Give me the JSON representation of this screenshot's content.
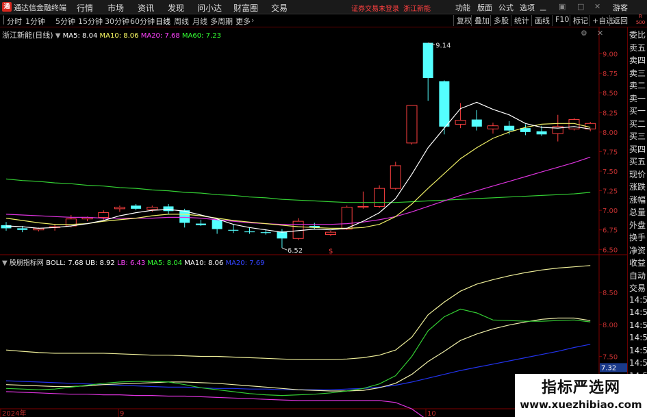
{
  "app": {
    "title": "通达信金融终端",
    "logo_glyph": "通"
  },
  "menu": [
    "行情",
    "市场",
    "资讯",
    "发现",
    "问小达",
    "财富圈",
    "交易"
  ],
  "notice": {
    "broker": "证券交易未登录",
    "stock": "浙江新能"
  },
  "right_menu": [
    "功能",
    "版面",
    "公式",
    "选项"
  ],
  "user": "游客",
  "toolbar": {
    "periods": [
      "分时",
      "1分钟",
      "5分钟",
      "15分钟",
      "30分钟",
      "60分钟",
      "日线",
      "周线",
      "月线",
      "多周期",
      "更多"
    ],
    "active": "日线",
    "right": [
      "复权",
      "叠加",
      "多股",
      "统计",
      "画线",
      "F10",
      "标记",
      "+自选",
      "返回"
    ]
  },
  "side_panel": [
    "委比",
    "卖五",
    "卖四",
    "卖三",
    "卖二",
    "卖一",
    "买一",
    "买二",
    "买三",
    "买四",
    "买五",
    "现价",
    "涨跌",
    "涨幅",
    "总量",
    "外盘",
    "换手",
    "净资",
    "收益",
    "自动",
    "交易",
    "14:56",
    "14:56",
    "14:56",
    "14:56",
    "14:56",
    "14:56",
    "14:56",
    "14:56",
    "14:56"
  ],
  "rbadge": [
    "R",
    "500"
  ],
  "price_panel": {
    "stock_label": "浙江新能(日线)",
    "ma": [
      {
        "label": "MA5: 8.04",
        "color": "#ffffff"
      },
      {
        "label": "MA10: 8.06",
        "color": "#ffff66"
      },
      {
        "label": "MA20: 7.68",
        "color": "#ff44ff"
      },
      {
        "label": "MA60: 7.23",
        "color": "#33ff33"
      }
    ],
    "y_ticks": [
      "9.00",
      "8.75",
      "8.50",
      "8.25",
      "8.00",
      "7.75",
      "7.50",
      "7.25",
      "7.00",
      "6.75",
      "6.50"
    ],
    "high_label": "9.14",
    "low_label": "6.52",
    "marker": "$"
  },
  "boll_panel": {
    "label": "股朋指标网",
    "boll": {
      "label": "BOLL: 7.68",
      "color": "#ffffff"
    },
    "items": [
      {
        "label": "UB: 8.92",
        "color": "#ffffff"
      },
      {
        "label": "LB: 6.43",
        "color": "#ff44ff"
      },
      {
        "label": "MA5: 8.04",
        "color": "#33ff33"
      },
      {
        "label": "MA10: 8.06",
        "color": "#ffffff"
      },
      {
        "label": "MA20: 7.69",
        "color": "#3344ff"
      }
    ],
    "y_ticks": [
      "8.50",
      "8.00",
      "7.50",
      "7.00"
    ],
    "current_value": "7.32"
  },
  "x_axis": [
    "2024年",
    "9",
    "10"
  ],
  "watermark": {
    "title": "指标严选网",
    "url": "www.xuezhibiao.com"
  },
  "chart_data": {
    "type": "candlestick",
    "y_range": [
      6.45,
      9.25
    ],
    "candles": [
      {
        "o": 6.81,
        "h": 6.85,
        "l": 6.74,
        "c": 6.77
      },
      {
        "o": 6.77,
        "h": 6.8,
        "l": 6.72,
        "c": 6.75
      },
      {
        "o": 6.75,
        "h": 6.78,
        "l": 6.73,
        "c": 6.77
      },
      {
        "o": 6.78,
        "h": 6.82,
        "l": 6.74,
        "c": 6.79
      },
      {
        "o": 6.8,
        "h": 6.94,
        "l": 6.78,
        "c": 6.89
      },
      {
        "o": 6.89,
        "h": 6.92,
        "l": 6.86,
        "c": 6.91
      },
      {
        "o": 6.91,
        "h": 7.0,
        "l": 6.88,
        "c": 6.97
      },
      {
        "o": 7.02,
        "h": 7.06,
        "l": 6.98,
        "c": 7.04
      },
      {
        "o": 7.06,
        "h": 7.08,
        "l": 7.0,
        "c": 7.02
      },
      {
        "o": 7.01,
        "h": 7.06,
        "l": 6.98,
        "c": 7.04
      },
      {
        "o": 7.05,
        "h": 7.08,
        "l": 6.95,
        "c": 6.99
      },
      {
        "o": 7.0,
        "h": 7.02,
        "l": 6.78,
        "c": 6.84
      },
      {
        "o": 6.83,
        "h": 6.88,
        "l": 6.8,
        "c": 6.81
      },
      {
        "o": 6.88,
        "h": 6.9,
        "l": 6.7,
        "c": 6.76
      },
      {
        "o": 6.75,
        "h": 6.82,
        "l": 6.71,
        "c": 6.74
      },
      {
        "o": 6.73,
        "h": 6.78,
        "l": 6.7,
        "c": 6.72
      },
      {
        "o": 6.72,
        "h": 6.76,
        "l": 6.69,
        "c": 6.71
      },
      {
        "o": 6.73,
        "h": 6.76,
        "l": 6.52,
        "c": 6.64
      },
      {
        "o": 6.64,
        "h": 6.9,
        "l": 6.62,
        "c": 6.86
      },
      {
        "o": 6.8,
        "h": 6.84,
        "l": 6.76,
        "c": 6.78
      },
      {
        "o": 6.69,
        "h": 6.74,
        "l": 6.67,
        "c": 6.72
      },
      {
        "o": 6.76,
        "h": 7.06,
        "l": 6.75,
        "c": 7.04
      },
      {
        "o": 7.04,
        "h": 7.24,
        "l": 7.02,
        "c": 7.05
      },
      {
        "o": 7.05,
        "h": 7.32,
        "l": 7.03,
        "c": 7.28
      },
      {
        "o": 7.28,
        "h": 7.62,
        "l": 7.26,
        "c": 7.57
      },
      {
        "o": 7.86,
        "h": 8.34,
        "l": 7.84,
        "c": 8.34
      },
      {
        "o": 9.14,
        "h": 9.14,
        "l": 8.4,
        "c": 8.69
      },
      {
        "o": 8.65,
        "h": 8.66,
        "l": 7.97,
        "c": 8.07
      },
      {
        "o": 8.1,
        "h": 8.37,
        "l": 8.05,
        "c": 8.15
      },
      {
        "o": 8.16,
        "h": 8.28,
        "l": 8.02,
        "c": 8.07
      },
      {
        "o": 8.04,
        "h": 8.12,
        "l": 7.98,
        "c": 8.08
      },
      {
        "o": 8.08,
        "h": 8.14,
        "l": 7.97,
        "c": 8.02
      },
      {
        "o": 8.05,
        "h": 8.1,
        "l": 7.96,
        "c": 8.0
      },
      {
        "o": 8.01,
        "h": 8.08,
        "l": 7.95,
        "c": 7.97
      },
      {
        "o": 7.98,
        "h": 8.22,
        "l": 7.88,
        "c": 8.07
      },
      {
        "o": 8.04,
        "h": 8.18,
        "l": 8.02,
        "c": 8.16
      },
      {
        "o": 8.04,
        "h": 8.13,
        "l": 8.01,
        "c": 8.11
      }
    ],
    "ma5": [
      6.8,
      6.79,
      6.77,
      6.78,
      6.8,
      6.83,
      6.87,
      6.93,
      6.97,
      7.0,
      7.01,
      6.99,
      6.94,
      6.89,
      6.82,
      6.78,
      6.75,
      6.72,
      6.74,
      6.76,
      6.75,
      6.77,
      6.86,
      6.97,
      7.15,
      7.46,
      7.8,
      8.05,
      8.3,
      8.38,
      8.29,
      8.22,
      8.11,
      8.06,
      8.05,
      8.07,
      8.04
    ],
    "ma10": [
      6.9,
      6.87,
      6.84,
      6.82,
      6.82,
      6.83,
      6.86,
      6.88,
      6.9,
      6.93,
      6.95,
      6.95,
      6.93,
      6.9,
      6.87,
      6.85,
      6.83,
      6.81,
      6.79,
      6.78,
      6.77,
      6.77,
      6.78,
      6.82,
      6.92,
      7.08,
      7.28,
      7.47,
      7.66,
      7.8,
      7.92,
      8.0,
      8.06,
      8.1,
      8.11,
      8.11,
      8.06
    ],
    "ma20": [
      6.95,
      6.94,
      6.93,
      6.92,
      6.91,
      6.91,
      6.9,
      6.9,
      6.9,
      6.9,
      6.91,
      6.91,
      6.9,
      6.88,
      6.86,
      6.84,
      6.83,
      6.82,
      6.82,
      6.82,
      6.82,
      6.83,
      6.85,
      6.88,
      6.92,
      6.98,
      7.05,
      7.12,
      7.19,
      7.25,
      7.31,
      7.37,
      7.43,
      7.49,
      7.55,
      7.61,
      7.68
    ],
    "ma60": [
      7.4,
      7.38,
      7.37,
      7.35,
      7.34,
      7.32,
      7.31,
      7.29,
      7.28,
      7.26,
      7.25,
      7.23,
      7.22,
      7.2,
      7.19,
      7.17,
      7.16,
      7.14,
      7.13,
      7.12,
      7.11,
      7.1,
      7.1,
      7.1,
      7.1,
      7.11,
      7.12,
      7.13,
      7.14,
      7.15,
      7.16,
      7.17,
      7.18,
      7.19,
      7.2,
      7.21,
      7.23
    ],
    "boll_range": [
      6.65,
      8.95
    ],
    "boll_ub": [
      7.6,
      7.58,
      7.56,
      7.55,
      7.55,
      7.55,
      7.55,
      7.54,
      7.53,
      7.52,
      7.52,
      7.51,
      7.5,
      7.5,
      7.49,
      7.48,
      7.47,
      7.46,
      7.45,
      7.45,
      7.45,
      7.46,
      7.48,
      7.52,
      7.6,
      7.8,
      8.15,
      8.35,
      8.52,
      8.63,
      8.7,
      8.76,
      8.81,
      8.85,
      8.88,
      8.9,
      8.92
    ],
    "boll_mid": [
      7.09,
      7.08,
      7.07,
      7.06,
      7.05,
      7.04,
      7.04,
      7.03,
      7.03,
      7.02,
      7.01,
      7.0,
      6.99,
      6.98,
      6.97,
      6.96,
      6.95,
      6.94,
      6.93,
      6.93,
      6.93,
      6.94,
      6.96,
      7.0,
      7.05,
      7.11,
      7.17,
      7.23,
      7.29,
      7.34,
      7.39,
      7.44,
      7.49,
      7.54,
      7.59,
      7.64,
      7.68
    ],
    "boll_lb": [
      6.95,
      6.94,
      6.93,
      6.92,
      6.91,
      6.91,
      6.9,
      6.9,
      6.89,
      6.89,
      6.88,
      6.88,
      6.87,
      6.86,
      6.85,
      6.84,
      6.83,
      6.82,
      6.81,
      6.81,
      6.81,
      6.81,
      6.81,
      6.81,
      6.78,
      6.68,
      6.5,
      6.45,
      6.43,
      6.43,
      6.43,
      6.43,
      6.43,
      6.43,
      6.43,
      6.43,
      6.43
    ],
    "boll_ma5": [
      7.0,
      6.99,
      6.98,
      6.99,
      7.02,
      7.05,
      7.08,
      7.1,
      7.11,
      7.11,
      7.1,
      7.06,
      7.01,
      6.98,
      6.95,
      6.92,
      6.9,
      6.89,
      6.9,
      6.91,
      6.93,
      6.96,
      7.0,
      7.07,
      7.2,
      7.5,
      7.9,
      8.12,
      8.24,
      8.18,
      8.07,
      8.06,
      8.05,
      8.05,
      8.06,
      8.07,
      8.04
    ],
    "boll_ma10": [
      7.06,
      7.05,
      7.04,
      7.03,
      7.03,
      7.04,
      7.06,
      7.07,
      7.08,
      7.09,
      7.1,
      7.1,
      7.09,
      7.08,
      7.06,
      7.04,
      7.02,
      7.0,
      6.98,
      6.97,
      6.96,
      6.96,
      6.97,
      7.01,
      7.08,
      7.22,
      7.42,
      7.58,
      7.75,
      7.85,
      7.93,
      7.99,
      8.04,
      8.08,
      8.1,
      8.1,
      8.06
    ],
    "boll_ma20": [
      7.12,
      7.11,
      7.1,
      7.09,
      7.08,
      7.07,
      7.06,
      7.05,
      7.04,
      7.03,
      7.02,
      7.02,
      7.01,
      7.0,
      7.0,
      6.99,
      6.99,
      6.98,
      6.98,
      6.98,
      6.98,
      6.99,
      7.0,
      7.02,
      7.05,
      7.1,
      7.16,
      7.22,
      7.28,
      7.33,
      7.38,
      7.43,
      7.48,
      7.53,
      7.58,
      7.64,
      7.69
    ]
  }
}
